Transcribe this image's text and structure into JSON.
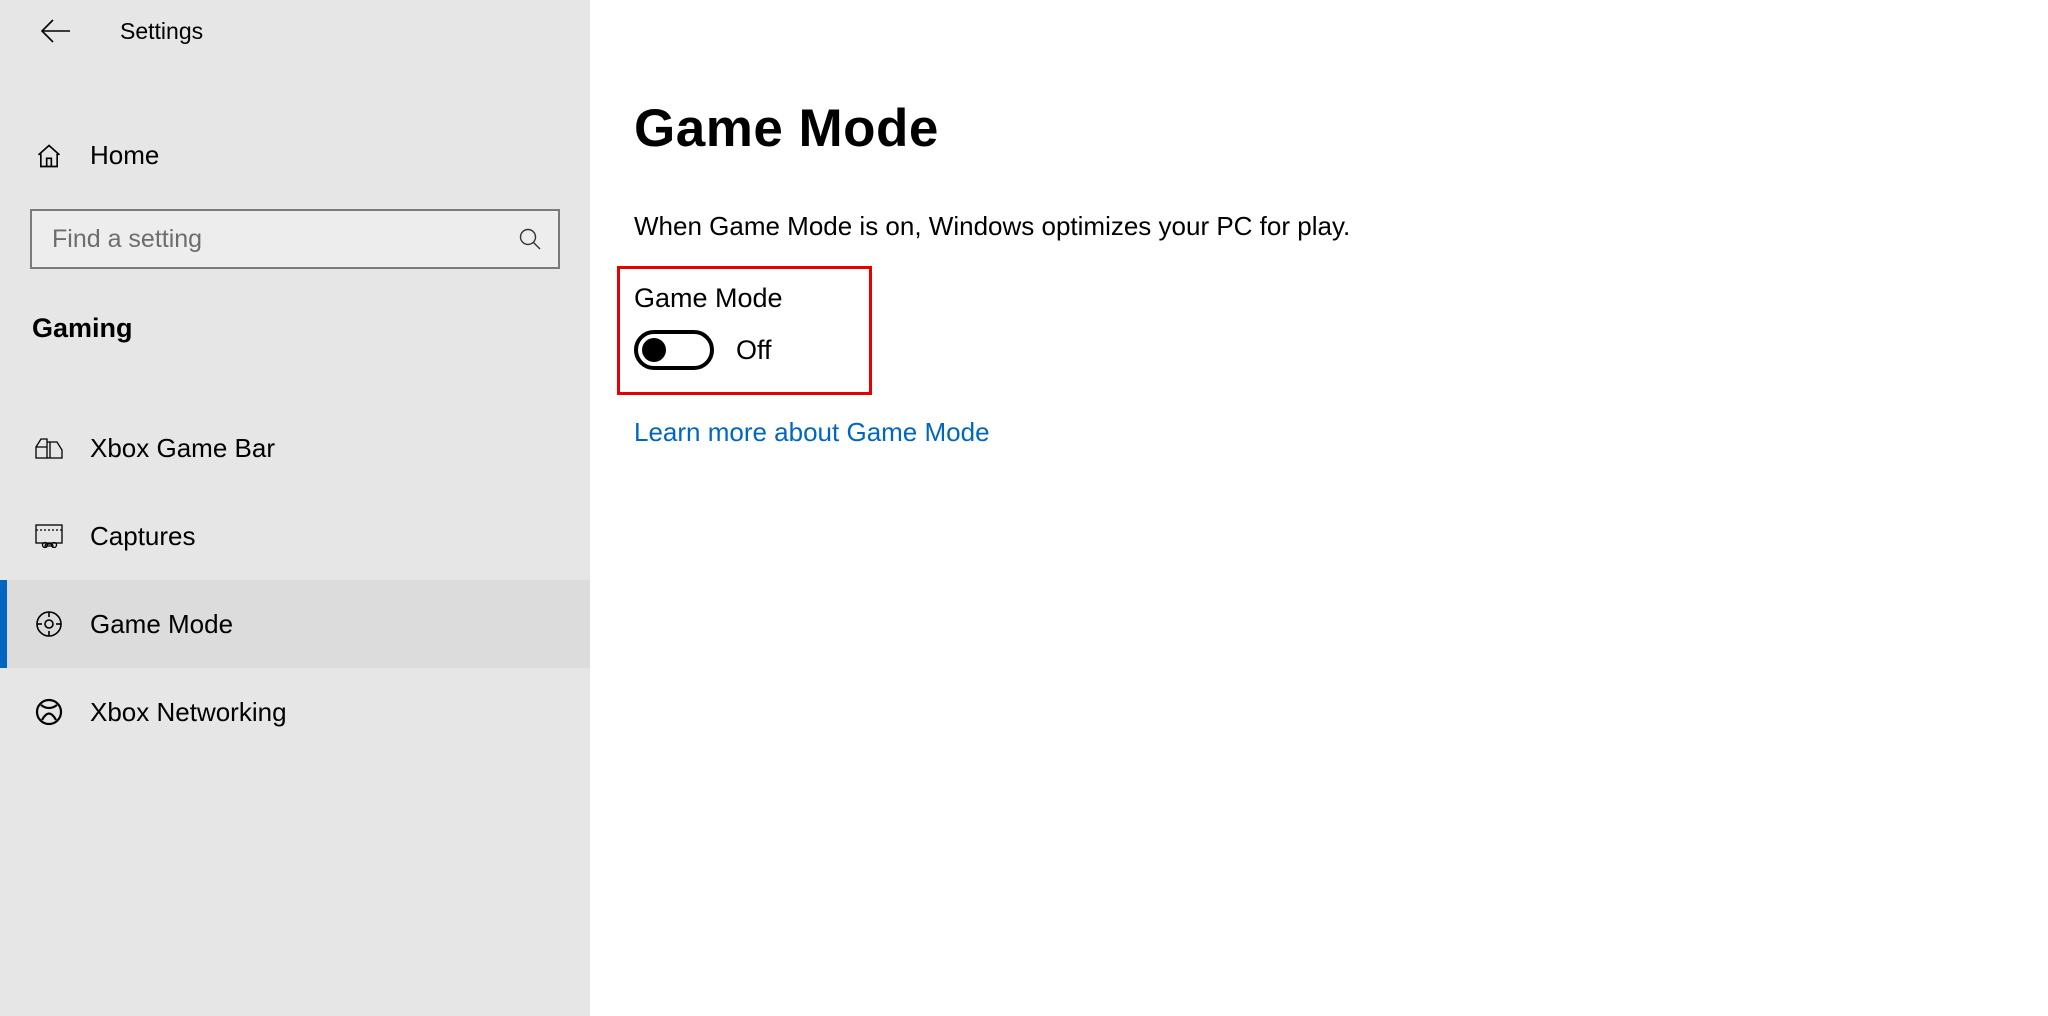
{
  "sidebar": {
    "title": "Settings",
    "home_label": "Home",
    "search_placeholder": "Find a setting",
    "section_header": "Gaming",
    "items": [
      {
        "label": "Xbox Game Bar"
      },
      {
        "label": "Captures"
      },
      {
        "label": "Game Mode"
      },
      {
        "label": "Xbox Networking"
      }
    ]
  },
  "main": {
    "title": "Game Mode",
    "description": "When Game Mode is on, Windows optimizes your PC for play.",
    "toggle_label": "Game Mode",
    "toggle_state": "Off",
    "learn_more": "Learn more about Game Mode"
  }
}
